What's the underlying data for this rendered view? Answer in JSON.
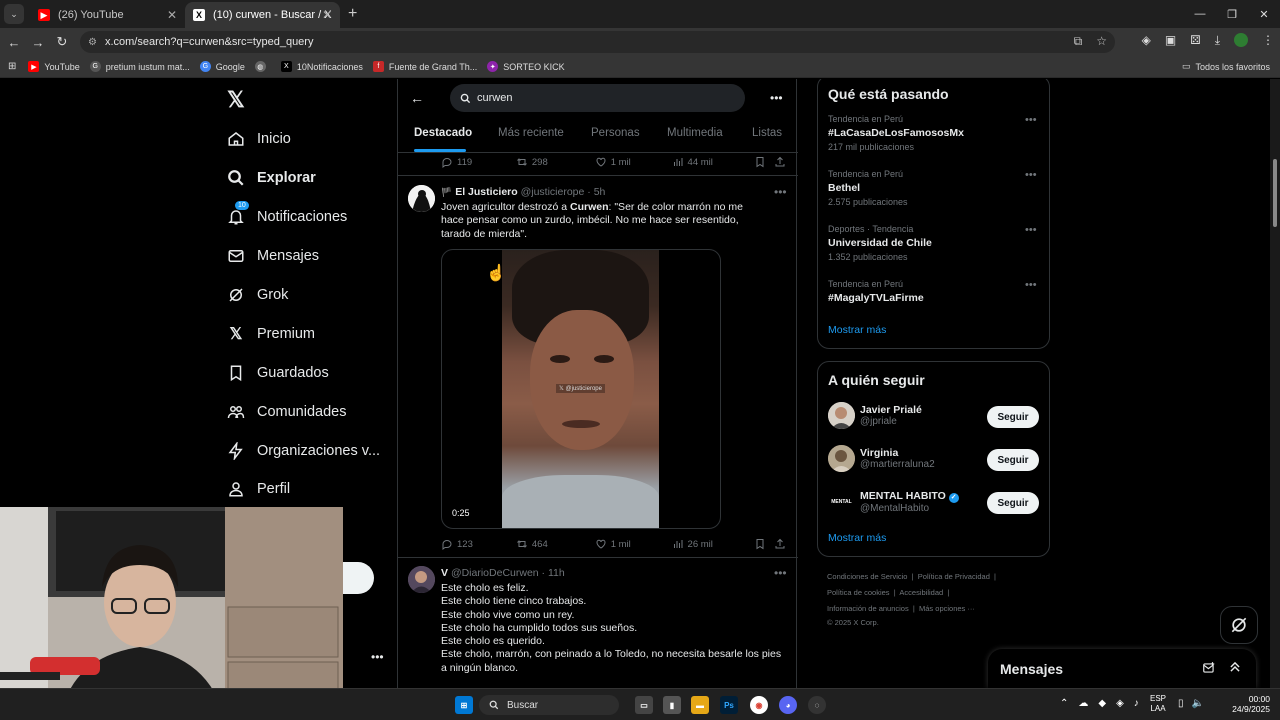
{
  "browser": {
    "tabs": [
      {
        "title": "(26) YouTube",
        "active": false
      },
      {
        "title": "(10) curwen - Buscar / X",
        "active": true
      }
    ],
    "url": "x.com/search?q=curwen&src=typed_query",
    "bookmarks": [
      "YouTube",
      "pretium iustum mat...",
      "Google",
      "10Notificaciones",
      "Fuente de Grand Th...",
      "SORTEO KICK"
    ],
    "all_bookmarks": "Todos los favoritos"
  },
  "nav": {
    "items": [
      {
        "label": "Inicio",
        "icon": "home-icon"
      },
      {
        "label": "Explorar",
        "icon": "search-icon",
        "bold": true
      },
      {
        "label": "Notificaciones",
        "icon": "bell-icon",
        "badge": "10"
      },
      {
        "label": "Mensajes",
        "icon": "mail-icon"
      },
      {
        "label": "Grok",
        "icon": "grok-icon"
      },
      {
        "label": "Premium",
        "icon": "x-logo-icon"
      },
      {
        "label": "Guardados",
        "icon": "bookmark-icon"
      },
      {
        "label": "Comunidades",
        "icon": "people-icon"
      },
      {
        "label": "Organizaciones v...",
        "icon": "bolt-icon"
      },
      {
        "label": "Perfil",
        "icon": "person-icon"
      }
    ]
  },
  "search": {
    "query": "curwen",
    "tabs": [
      "Destacado",
      "Más reciente",
      "Personas",
      "Multimedia",
      "Listas"
    ]
  },
  "prev_tweet_stats": {
    "replies": "119",
    "retweets": "298",
    "likes": "1 mil",
    "views": "44 mil"
  },
  "tweet1": {
    "name": "El Justiciero",
    "handle": "@justicierope",
    "time": "5h",
    "text_pre": "Joven agricultor destrozó a ",
    "text_bold": "Curwen",
    "text_post": ": \"Ser de color marrón no me hace pensar como un zurdo, imbécil. No me hace ser resentido, tarado de mierda\".",
    "video_watermark": "@justicierope",
    "duration": "0:25",
    "replies": "123",
    "retweets": "464",
    "likes": "1 mil",
    "views": "26 mil"
  },
  "tweet2": {
    "name": "V",
    "handle": "@DiarioDeCurwen",
    "time": "11h",
    "lines": [
      "Este cholo es feliz.",
      "Este cholo tiene cinco trabajos.",
      "Este cholo vive como un rey.",
      "Este cholo ha cumplido todos sus sueños.",
      "Este cholo es querido.",
      "Este cholo, marrón, con peinado a lo Toledo, no necesita besarle los pies a ningún blanco."
    ]
  },
  "trends": {
    "title": "Qué está pasando",
    "items": [
      {
        "meta": "Tendencia en Perú",
        "name": "#LaCasaDeLosFamososMx",
        "count": "217 mil publicaciones"
      },
      {
        "meta": "Tendencia en Perú",
        "name": "Bethel",
        "count": "2.575 publicaciones"
      },
      {
        "meta": "Deportes · Tendencia",
        "name": "Universidad de Chile",
        "count": "1.352 publicaciones"
      },
      {
        "meta": "Tendencia en Perú",
        "name": "#MagalyTVLaFirme",
        "count": ""
      }
    ],
    "show_more": "Mostrar más"
  },
  "who_to_follow": {
    "title": "A quién seguir",
    "items": [
      {
        "name": "Javier Prialé",
        "handle": "@jpriale",
        "verified": false
      },
      {
        "name": "Virginia",
        "handle": "@martierraluna2",
        "verified": false
      },
      {
        "name": "MENTAL HABITO",
        "handle": "@MentalHabito",
        "verified": true
      }
    ],
    "follow_label": "Seguir",
    "show_more": "Mostrar más",
    "avatar_text": "MENTAL"
  },
  "footer": {
    "row1": [
      "Condiciones de Servicio",
      "Política de Privacidad"
    ],
    "row2": [
      "Política de cookies",
      "Accesibilidad"
    ],
    "row3": [
      "Información de anuncios",
      "Más opciones ···"
    ],
    "copyright": "© 2025 X Corp."
  },
  "messages_drawer": "Mensajes",
  "taskbar": {
    "search": "Buscar",
    "lang1": "ESP",
    "lang2": "LAA",
    "time": "00:00",
    "date": "24/9/2025"
  },
  "colors": {
    "accent": "#1d9bf0",
    "bg": "#000000",
    "border": "#2f3336",
    "muted": "#71767b"
  }
}
